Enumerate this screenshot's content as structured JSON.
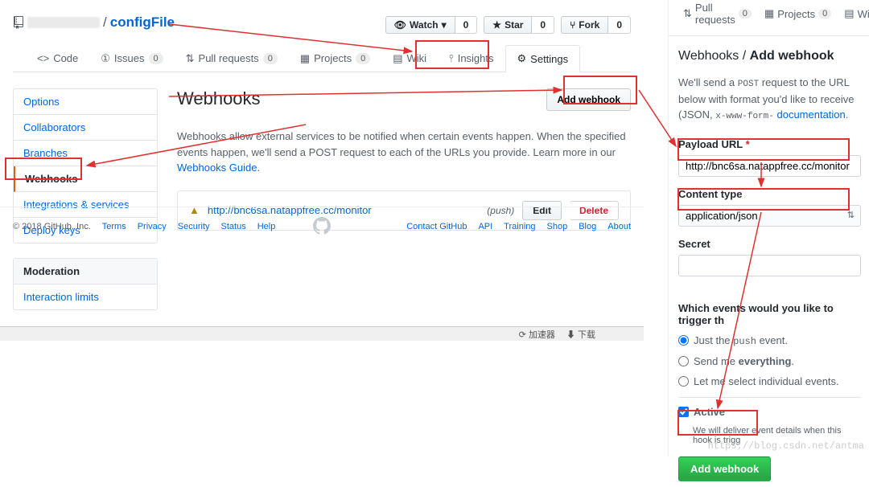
{
  "repo": {
    "name": "configFile",
    "sep": "/"
  },
  "actions": {
    "watch": {
      "label": "Watch",
      "count": "0"
    },
    "star": {
      "label": "Star",
      "count": "0"
    },
    "fork": {
      "label": "Fork",
      "count": "0"
    }
  },
  "tabs": {
    "code": "Code",
    "issues": {
      "label": "Issues",
      "count": "0"
    },
    "pulls": {
      "label": "Pull requests",
      "count": "0"
    },
    "projects": {
      "label": "Projects",
      "count": "0"
    },
    "wiki": "Wiki",
    "insights": "Insights",
    "settings": "Settings"
  },
  "sidebar": {
    "items": [
      "Options",
      "Collaborators",
      "Branches",
      "Webhooks",
      "Integrations & services",
      "Deploy keys"
    ],
    "moderation_header": "Moderation",
    "moderation_items": [
      "Interaction limits"
    ]
  },
  "webhooks": {
    "title": "Webhooks",
    "add_btn": "Add webhook",
    "desc_1": "Webhooks allow external services to be notified when certain events happen. When the specified events happen, we'll send a POST request to each of the URLs you provide. Learn more in our ",
    "desc_link": "Webhooks Guide",
    "hook_url": "http://bnc6sa.natappfree.cc/monitor",
    "hook_event": "(push)",
    "edit": "Edit",
    "delete": "Delete"
  },
  "footer": {
    "copyright": "© 2018 GitHub, Inc.",
    "links_left": [
      "Terms",
      "Privacy",
      "Security",
      "Status",
      "Help"
    ],
    "links_right": [
      "Contact GitHub",
      "API",
      "Training",
      "Shop",
      "Blog",
      "About"
    ]
  },
  "right": {
    "mini_tabs": {
      "pulls": {
        "label": "Pull requests",
        "count": "0"
      },
      "projects": {
        "label": "Projects",
        "count": "0"
      },
      "wiki": "Wiki"
    },
    "breadcrumb_1": "Webhooks / ",
    "breadcrumb_2": "Add webhook",
    "intro_1": "We'll send a ",
    "intro_code1": "POST",
    "intro_2": " request to the URL below with",
    "intro_3": " format you'd like to receive (JSON, ",
    "intro_code2": "x-www-form-",
    "intro_link": "documentation",
    "payload_label": "Payload URL",
    "payload_value": "http://bnc6sa.natappfree.cc/monitor",
    "content_type_label": "Content type",
    "content_type_value": "application/json",
    "secret_label": "Secret",
    "events_q": "Which events would you like to trigger th",
    "radio_push_1": "Just the ",
    "radio_push_code": "push",
    "radio_push_2": " event.",
    "radio_everything_1": "Send me ",
    "radio_everything_2": "everything",
    "radio_individual": "Let me select individual events.",
    "active_label": "Active",
    "active_hint": "We will deliver event details when this hook is trigg",
    "submit": "Add webhook"
  },
  "taskbar": {
    "item1": "加速器",
    "item2": "下载"
  },
  "watermark": "https://blog.csdn.net/antma"
}
